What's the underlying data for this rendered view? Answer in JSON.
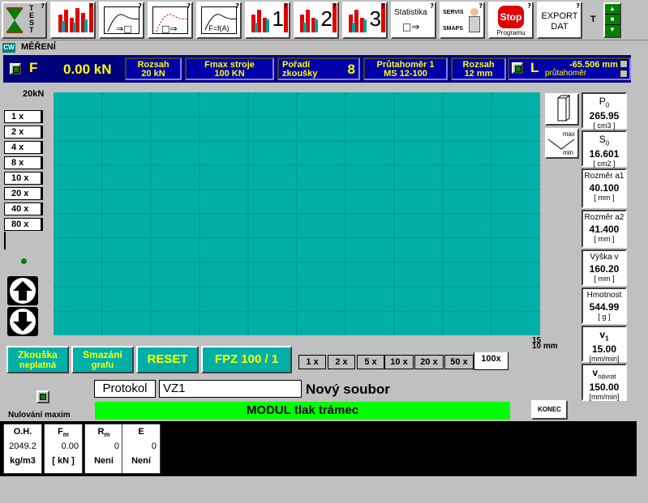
{
  "toolbar": {
    "buttons": [
      {
        "name": "test",
        "label": "TEST"
      },
      {
        "name": "graph-overview",
        "label": ""
      },
      {
        "name": "curve-to-box",
        "label": ""
      },
      {
        "name": "curve-dotted",
        "label": ""
      },
      {
        "name": "curve-f-of-a",
        "label": "F=f(A)"
      },
      {
        "name": "results-1",
        "label": "1"
      },
      {
        "name": "results-2",
        "label": "2"
      },
      {
        "name": "results-3",
        "label": "3"
      },
      {
        "name": "statistika",
        "label": "Statistika"
      },
      {
        "name": "servis",
        "label": "SERVIS",
        "label2": "SMAPS"
      },
      {
        "name": "stop-programu",
        "label": "Stop",
        "label2": "Programu"
      },
      {
        "name": "export-dat",
        "label": "EXPORT",
        "label2": "DAT"
      },
      {
        "name": "t",
        "label": "T"
      }
    ]
  },
  "window": {
    "title": "MĚŘENÍ",
    "icon_label": "CW"
  },
  "status": {
    "force_letter": "F",
    "force_value": "0.00 kN",
    "rozsah1_label": "Rozsah",
    "rozsah1_value": "20 kN",
    "fmax_label": "Fmax  stroje",
    "fmax_value": "100 KN",
    "poradi_label": "Pořadí",
    "poradi_label2": "zkoušky",
    "poradi_value": "8",
    "prut_label": "Průtahoměr 1",
    "prut_value": "MS 12-100",
    "rozsah2_label": "Rozsah",
    "rozsah2_value": "12 mm",
    "l_letter": "L",
    "l_value": "-65.506 mm",
    "l_sub": "průtahoměr"
  },
  "chart": {
    "y_max_label": "20kN",
    "x_max_label": "10 mm",
    "x_extra": "15"
  },
  "zoom_y": [
    "1 x",
    "2 x",
    "4 x",
    "8 x",
    "10 x",
    "20 x",
    "40 x",
    "80 x"
  ],
  "zoom_x": [
    "1 x",
    "2 x",
    "5 x",
    "10 x",
    "20 x",
    "50 x",
    "100x"
  ],
  "params": [
    {
      "name": "P",
      "sub": "0",
      "value": "265.95",
      "unit": "[ cm3 ]"
    },
    {
      "name": "S",
      "sub": "0",
      "value": "16.601",
      "unit": "[ cm2 ]"
    },
    {
      "name": "Rozměr a1",
      "sub": "",
      "value": "40.100",
      "unit": "[ mm ]"
    },
    {
      "name": "Rozměr a2",
      "sub": "",
      "value": "41.400",
      "unit": "[ mm ]"
    },
    {
      "name": "Výška v",
      "sub": "",
      "value": "160.20",
      "unit": "[ mm ]"
    },
    {
      "name": "Hmotnost",
      "sub": "",
      "value": "544.99",
      "unit": "[ g ]"
    },
    {
      "name": "v",
      "sub": "1",
      "value": "15.00",
      "unit": "[mm/min]"
    },
    {
      "name": "v",
      "sub": "návrat",
      "value": "150.00",
      "unit": "[mm/min]"
    }
  ],
  "maxmin": {
    "max": "max",
    "min": "min"
  },
  "buttons": {
    "zkouska": "Zkouška",
    "zkouska2": "neplatná",
    "smazani": "Smazání",
    "smazani2": "grafu",
    "reset": "RESET",
    "fpz": "FPZ 100  / 1"
  },
  "protokol": {
    "label": "Protokol",
    "value": "VZ1",
    "file_status": "Nový soubor"
  },
  "modul": "MODUL tlak trámec",
  "konec": "KONEC",
  "nulovani": "Nulování maxim",
  "results": [
    {
      "h": "O.H.",
      "v": "2049.2",
      "u": "kg/m3"
    },
    {
      "h": "F",
      "hs": "m",
      "v": "0.00",
      "u": "[ kN ]"
    },
    {
      "h": "R",
      "hs": "m",
      "v": "0",
      "u": "Není"
    },
    {
      "h": "E",
      "hs": "",
      "v": "0",
      "u": "Není"
    }
  ],
  "colors": {
    "chart_bg": "#00b0a8",
    "status_bg": "#0000a8",
    "status_text": "#ffff00",
    "modul_bg": "#00ff00"
  }
}
